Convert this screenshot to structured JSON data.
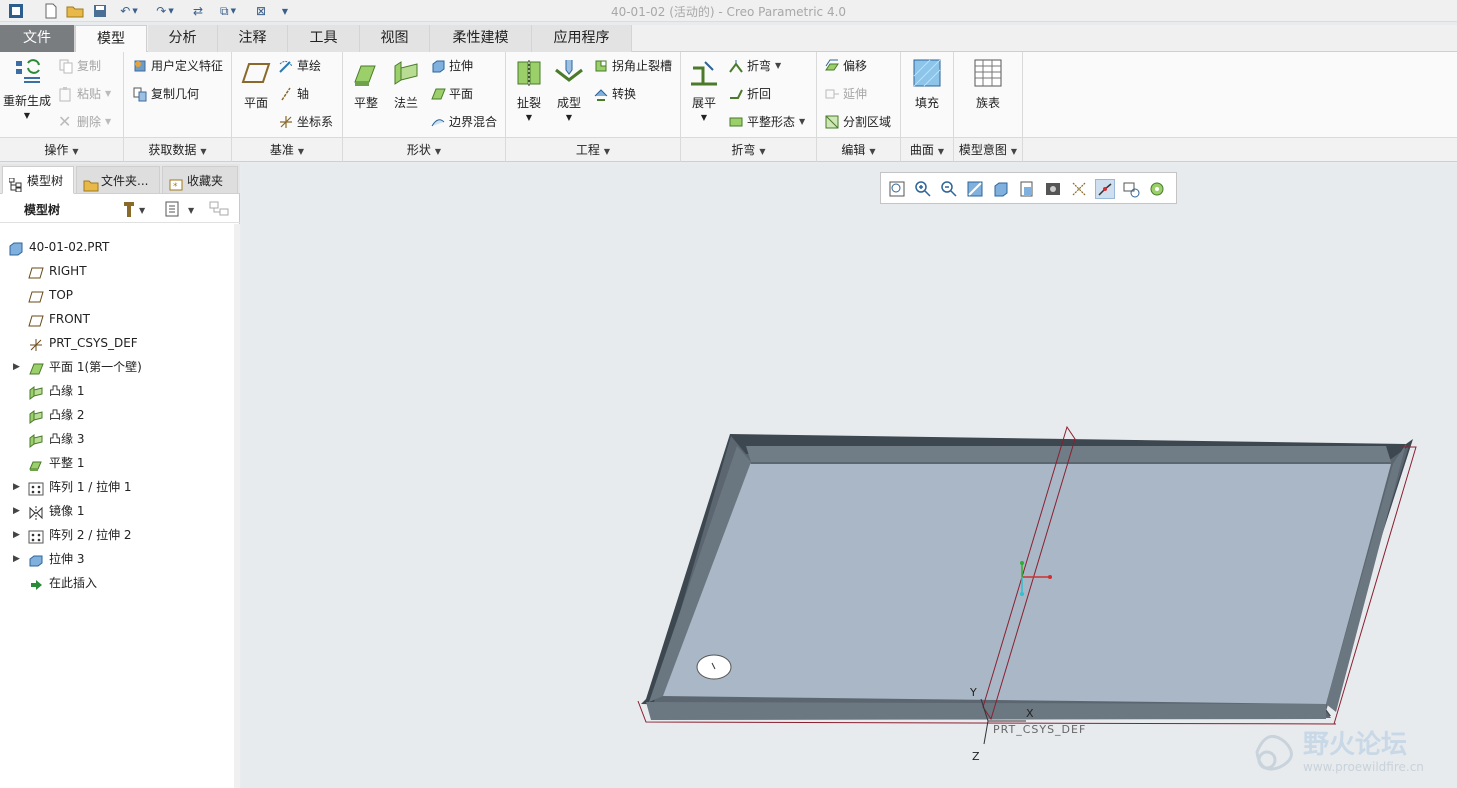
{
  "window": {
    "title": "40-01-02 (活动的) - Creo Parametric 4.0"
  },
  "tabs": [
    "文件",
    "模型",
    "分析",
    "注释",
    "工具",
    "视图",
    "柔性建模",
    "应用程序"
  ],
  "ribbon": {
    "ops": {
      "regen": "重新生成",
      "copy": "复制",
      "paste": "粘贴",
      "delete": "删除",
      "label": "操作"
    },
    "getdata": {
      "udf": "用户定义特征",
      "copygeom": "复制几何",
      "label": "获取数据"
    },
    "datum": {
      "plane": "平面",
      "sketch": "草绘",
      "axis": "轴",
      "csys": "坐标系",
      "label": "基准"
    },
    "shapes": {
      "flatten": "平整",
      "flange": "法兰",
      "extrude": "拉伸",
      "plane": "平面",
      "blend": "边界混合",
      "label": "形状"
    },
    "eng": {
      "rip": "扯裂",
      "form": "成型",
      "corner": "拐角止裂槽",
      "convert": "转换",
      "label": "工程"
    },
    "bend": {
      "unbend": "展平",
      "bend": "折弯",
      "bendback": "折回",
      "flatform": "平整形态",
      "label": "折弯"
    },
    "edit": {
      "offset": "偏移",
      "extend": "延伸",
      "split": "分割区域",
      "label": "编辑"
    },
    "surface": {
      "fill": "填充",
      "label": "曲面"
    },
    "intent": {
      "family": "族表",
      "label": "模型意图"
    }
  },
  "panel": {
    "tabs": [
      "模型树",
      "文件夹...",
      "收藏夹"
    ],
    "header": "模型树",
    "nodes": [
      {
        "label": "40-01-02.PRT",
        "icon": "part-icon",
        "expand": false
      },
      {
        "label": "RIGHT",
        "icon": "datum-plane-icon",
        "expand": false
      },
      {
        "label": "TOP",
        "icon": "datum-plane-icon",
        "expand": false
      },
      {
        "label": "FRONT",
        "icon": "datum-plane-icon",
        "expand": false
      },
      {
        "label": "PRT_CSYS_DEF",
        "icon": "csys-icon",
        "expand": false
      },
      {
        "label": "平面 1(第一个壁)",
        "icon": "flat-wall-icon",
        "expand": true
      },
      {
        "label": "凸缘 1",
        "icon": "flange-icon",
        "expand": false
      },
      {
        "label": "凸缘 2",
        "icon": "flange-icon",
        "expand": false
      },
      {
        "label": "凸缘 3",
        "icon": "flange-icon",
        "expand": false
      },
      {
        "label": "平整 1",
        "icon": "flatten-icon",
        "expand": false
      },
      {
        "label": "阵列 1 / 拉伸 1",
        "icon": "pattern-icon",
        "expand": true
      },
      {
        "label": "镜像 1",
        "icon": "mirror-icon",
        "expand": true
      },
      {
        "label": "阵列 2 / 拉伸 2",
        "icon": "pattern-icon",
        "expand": true
      },
      {
        "label": "拉伸 3",
        "icon": "extrude-icon",
        "expand": true
      },
      {
        "label": "在此插入",
        "icon": "insert-here-icon",
        "expand": false
      }
    ]
  },
  "viewport": {
    "csys_label": "PRT_CSYS_DEF",
    "axis_x": "X",
    "axis_y": "Y",
    "axis_z": "Z"
  },
  "watermark": {
    "name": "野火论坛",
    "url": "www.proewildfire.cn"
  },
  "colors": {
    "file_tab": "#7a7d80",
    "ribbon_bg": "#fafafa",
    "part_fill": "#a9b7c6",
    "datum": "#8a2030"
  }
}
